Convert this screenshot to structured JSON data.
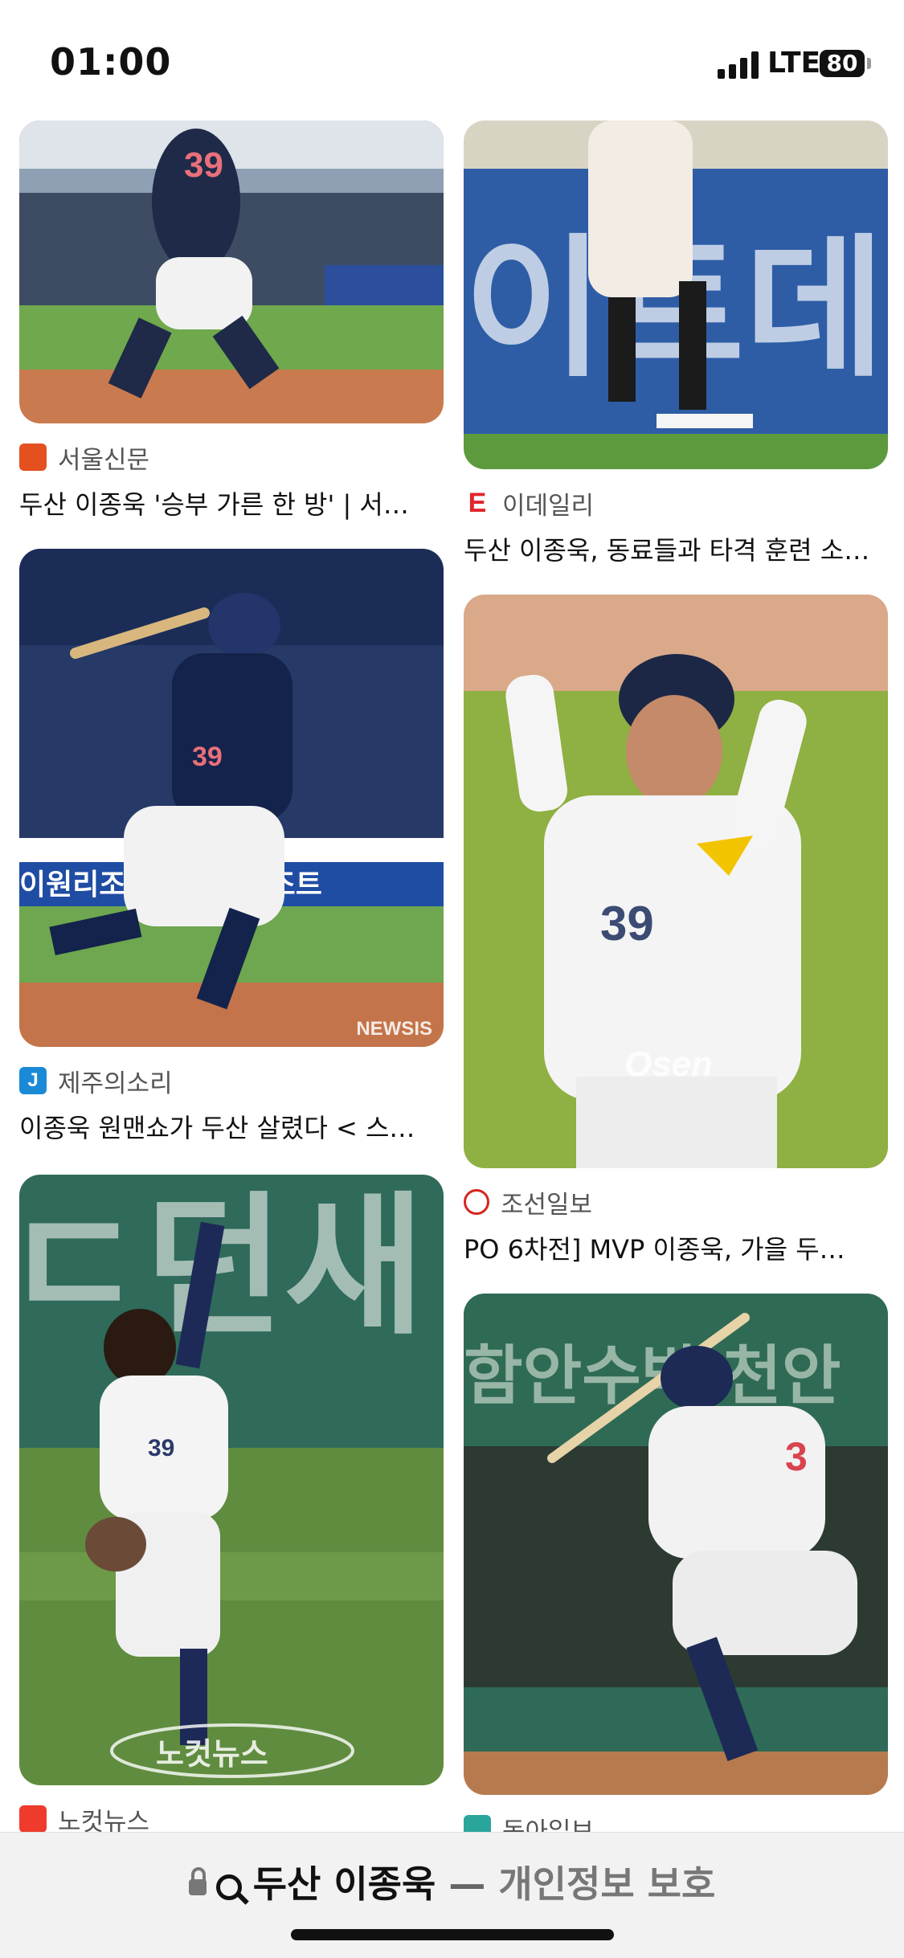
{
  "status_bar": {
    "time": "01:00",
    "network": "LTE",
    "battery": "80"
  },
  "results": [
    {
      "source": "서울신문",
      "logo_letter": "",
      "logo_color": "#e5501f",
      "title": "두산 이종욱 '승부 가른 한 방' | 서…"
    },
    {
      "source": "이데일리",
      "logo_letter": "E",
      "logo_color": "#e0252b",
      "title": "두산 이종욱, 동료들과 타격 훈련 소…"
    },
    {
      "source": "제주의소리",
      "logo_letter": "J",
      "logo_color": "#1a8ad6",
      "title": "이종욱 원맨쇼가 두산 살렸다 < 스…",
      "watermark": "NEWSIS"
    },
    {
      "source": "조선일보",
      "logo_letter": "",
      "logo_color": "#d5251e",
      "title": "PO 6차전] MVP 이종욱, 가을 두…",
      "watermark": "Osen"
    },
    {
      "source": "노컷뉴스",
      "logo_letter": "",
      "logo_color": "#ef3b2b",
      "title": "",
      "watermark": "노컷뉴스"
    },
    {
      "source": "동아일보",
      "logo_letter": "",
      "logo_color": "#2aa59b",
      "title": ""
    }
  ],
  "bottom_bar": {
    "query": "두산 이종욱",
    "separator": "—",
    "privacy_label": "개인정보 보호"
  }
}
